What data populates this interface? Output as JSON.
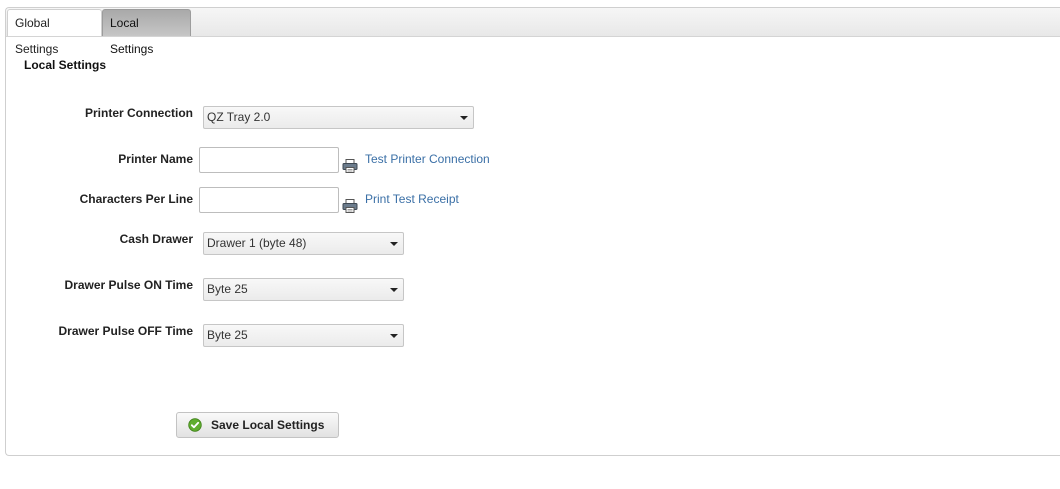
{
  "tabs": [
    {
      "label": "Global Settings",
      "active": false
    },
    {
      "label": "Local Settings",
      "active": true
    }
  ],
  "section_title": "Local Settings",
  "fields": {
    "printer_connection": {
      "label": "Printer Connection",
      "value": "QZ Tray 2.0"
    },
    "printer_name": {
      "label": "Printer Name",
      "value": "",
      "link": "Test Printer Connection"
    },
    "characters_per_line": {
      "label": "Characters Per Line",
      "value": "",
      "link": "Print Test Receipt"
    },
    "cash_drawer": {
      "label": "Cash Drawer",
      "value": "Drawer 1 (byte 48)"
    },
    "drawer_pulse_on": {
      "label": "Drawer Pulse ON Time",
      "value": "Byte 25"
    },
    "drawer_pulse_off": {
      "label": "Drawer Pulse OFF Time",
      "value": "Byte 25"
    }
  },
  "save_button_label": "Save Local Settings",
  "icons": {
    "printer": "printer-icon",
    "save": "check-circle-icon",
    "dropdown": "chevron-down-icon"
  },
  "colors": {
    "link": "#3a6fa6",
    "check": "#5fae2e",
    "active_tab": "#b3b3b3"
  }
}
